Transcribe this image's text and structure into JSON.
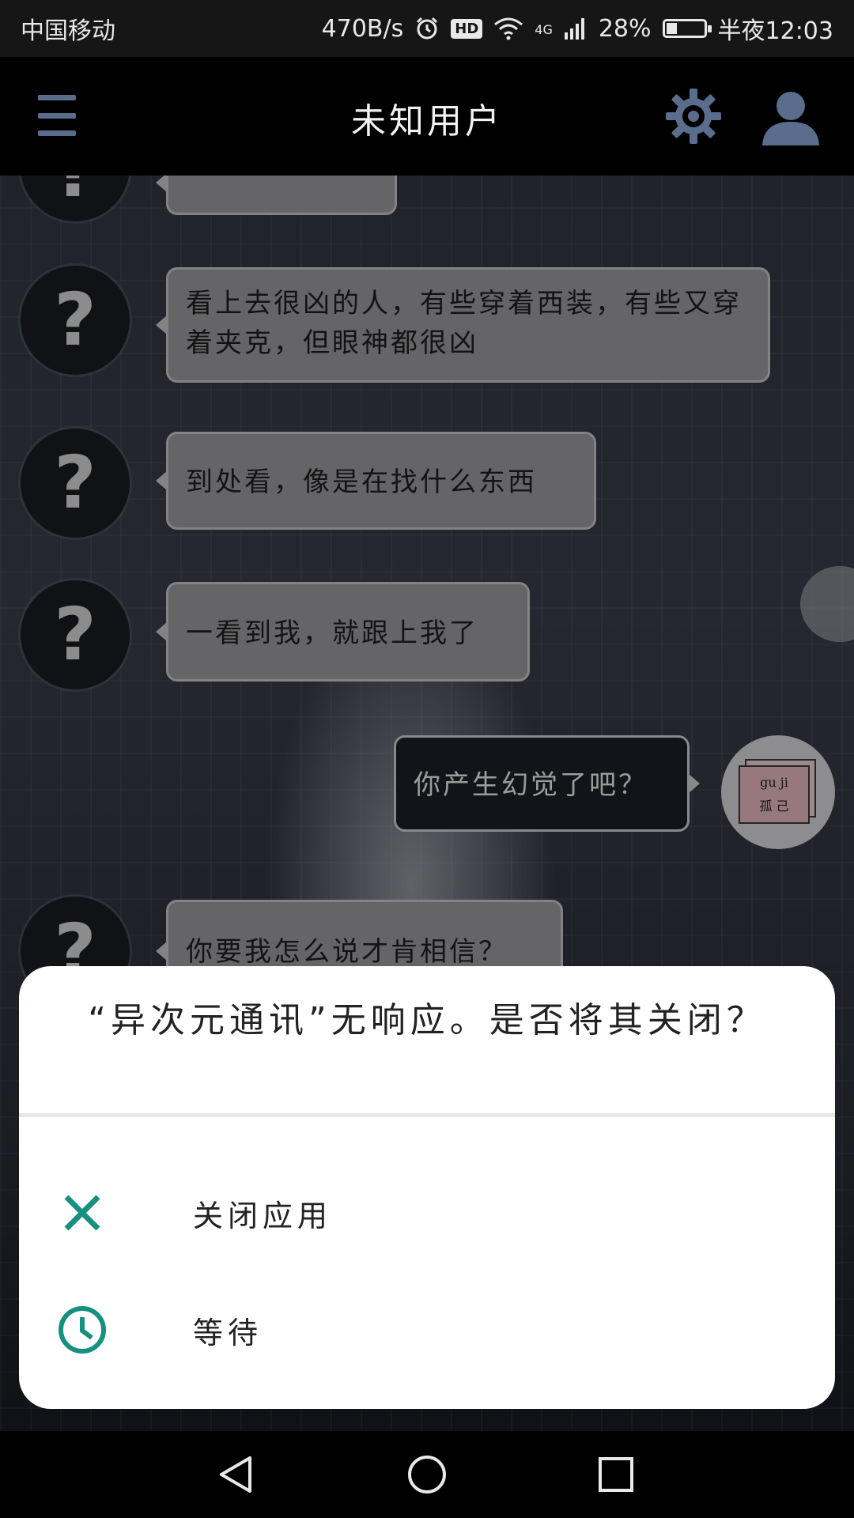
{
  "status_bar": {
    "carrier": "中国移动",
    "net_speed": "470B/s",
    "hd_badge": "HD",
    "network_type": "4G",
    "battery_level": "28%",
    "battery_fraction": 0.28,
    "time": "半夜12:03",
    "icons": [
      "alarm-icon",
      "wifi-icon",
      "signal-icon",
      "battery-icon"
    ]
  },
  "app_bar": {
    "title": "未知用户",
    "icons": [
      "menu-icon",
      "gear-icon",
      "user-icon"
    ],
    "icon_color": "#5a6d8c"
  },
  "chat": {
    "unknown_avatar": "?",
    "messages": [
      {
        "sender": "other",
        "text": "看上去很凶的人，有些穿着西装，有些又穿着夹克，但眼神都很凶"
      },
      {
        "sender": "other",
        "text": "到处看，像是在找什么东西"
      },
      {
        "sender": "other",
        "text": "一看到我，就跟上我了"
      },
      {
        "sender": "me",
        "text": "你产生幻觉了吧？"
      },
      {
        "sender": "other",
        "text": "你要我怎么说才肯相信？"
      }
    ],
    "my_avatar": {
      "line1": "gu  ji",
      "line2": "孤 己"
    }
  },
  "dialog": {
    "message": "“异次元通讯”无响应。是否将其关闭？",
    "actions": [
      {
        "label": "关闭应用",
        "icon": "close-icon"
      },
      {
        "label": "等待",
        "icon": "clock-icon"
      }
    ],
    "accent_color": "#16907f"
  },
  "nav_bar": {
    "icons": [
      "back-icon",
      "home-icon",
      "recents-icon"
    ]
  }
}
